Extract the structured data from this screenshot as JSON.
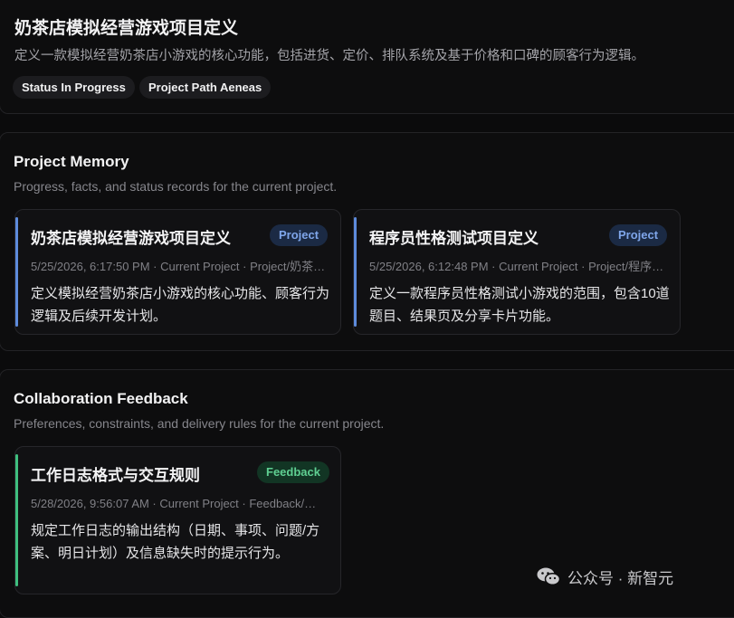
{
  "header": {
    "title": "奶茶店模拟经营游戏项目定义",
    "description": "定义一款模拟经营奶茶店小游戏的核心功能，包括进货、定价、排队系统及基于价格和口碑的顾客行为逻辑。",
    "tags": [
      "Status In Progress",
      "Project Path Aeneas"
    ]
  },
  "memory": {
    "title": "Project Memory",
    "description": "Progress, facts, and status records for the current project.",
    "cards": [
      {
        "title": "奶茶店模拟经营游戏项目定义",
        "badge": "Project",
        "meta": "5/25/2026, 6:17:50 PM · Current Project · Project/奶茶店模拟经营游戏项目定义",
        "body": "定义模拟经营奶茶店小游戏的核心功能、顾客行为逻辑及后续开发计划。"
      },
      {
        "title": "程序员性格测试项目定义",
        "badge": "Project",
        "meta": "5/25/2026, 6:12:48 PM · Current Project · Project/程序员性格测试项目定义",
        "body": "定义一款程序员性格测试小游戏的范围，包含10道题目、结果页及分享卡片功能。"
      }
    ]
  },
  "feedback": {
    "title": "Collaboration Feedback",
    "description": "Preferences, constraints, and delivery rules for the current project.",
    "cards": [
      {
        "title": "工作日志格式与交互规则",
        "badge": "Feedback",
        "meta": "5/28/2026, 9:56:07 AM · Current Project · Feedback/工作日志格式与交互规则",
        "body": "规定工作日志的输出结构（日期、事项、问题/方案、明日计划）及信息缺失时的提示行为。"
      }
    ]
  },
  "watermark": {
    "text": "公众号 · 新智元",
    "icon": "wechat-icon"
  }
}
